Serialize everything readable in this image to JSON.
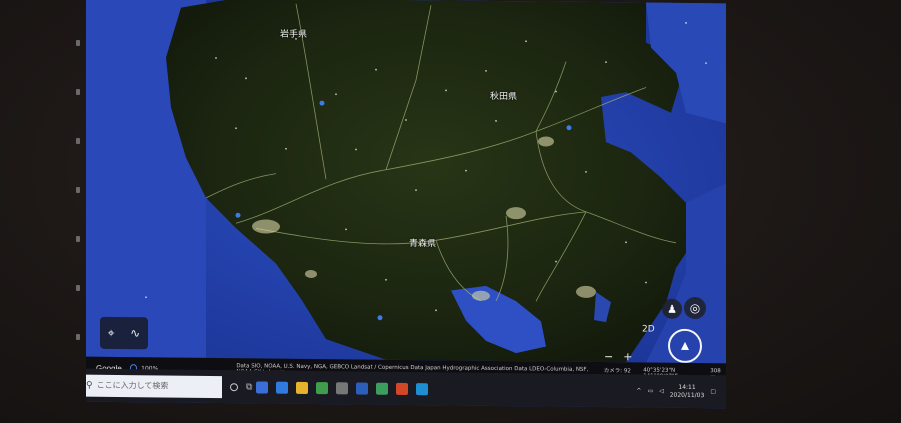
{
  "map": {
    "labels": {
      "iwate": "岩手県",
      "akita": "秋田県",
      "aomori": "青森県",
      "city_a": "",
      "city_b": "",
      "city_c": ""
    },
    "water_color": "#2a47b3",
    "land_color": "#1e2a12",
    "road_color": "#b9c28a"
  },
  "controls": {
    "view_mode": "2D",
    "zoom_in": "+",
    "zoom_out": "−"
  },
  "attribution": {
    "google": "Google",
    "percent": "100%",
    "credits": "Data SIO, NOAA, U.S. Navy, NGA, GEBCO  Landsat / Copernicus  Data Japan Hydrographic Association  Data LDEO-Columbia, NSF, NOAA  SK telecom",
    "scale": "カメラ: 92 km",
    "coords": "40°35'23\"N 141°09'07\"E",
    "elevation": "308 m"
  },
  "taskbar": {
    "search_placeholder": "ここに入力して検索",
    "time": "14:11",
    "date": "2020/11/03"
  }
}
